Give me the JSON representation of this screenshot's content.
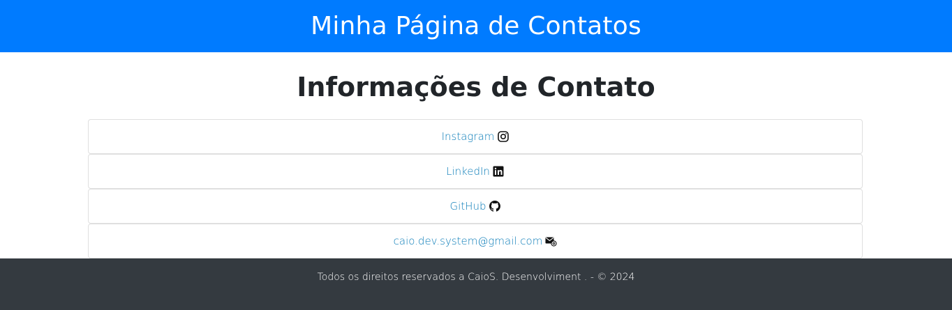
{
  "header": {
    "title": "Minha Página de Contatos"
  },
  "main": {
    "section_title": "Informações de Contato",
    "contacts": [
      {
        "label": "Instagram",
        "icon": "instagram-icon"
      },
      {
        "label": "LinkedIn",
        "icon": "linkedin-icon"
      },
      {
        "label": "GitHub",
        "icon": "github-icon"
      },
      {
        "label": "caio.dev.system@gmail.com",
        "icon": "email-icon"
      }
    ]
  },
  "footer": {
    "text": "Todos os direitos reservados a CaioS. Desenvolviment . - © 2024"
  },
  "colors": {
    "header_bg": "#007bff",
    "link": "#0a7cb8",
    "footer_bg": "#343a40"
  }
}
